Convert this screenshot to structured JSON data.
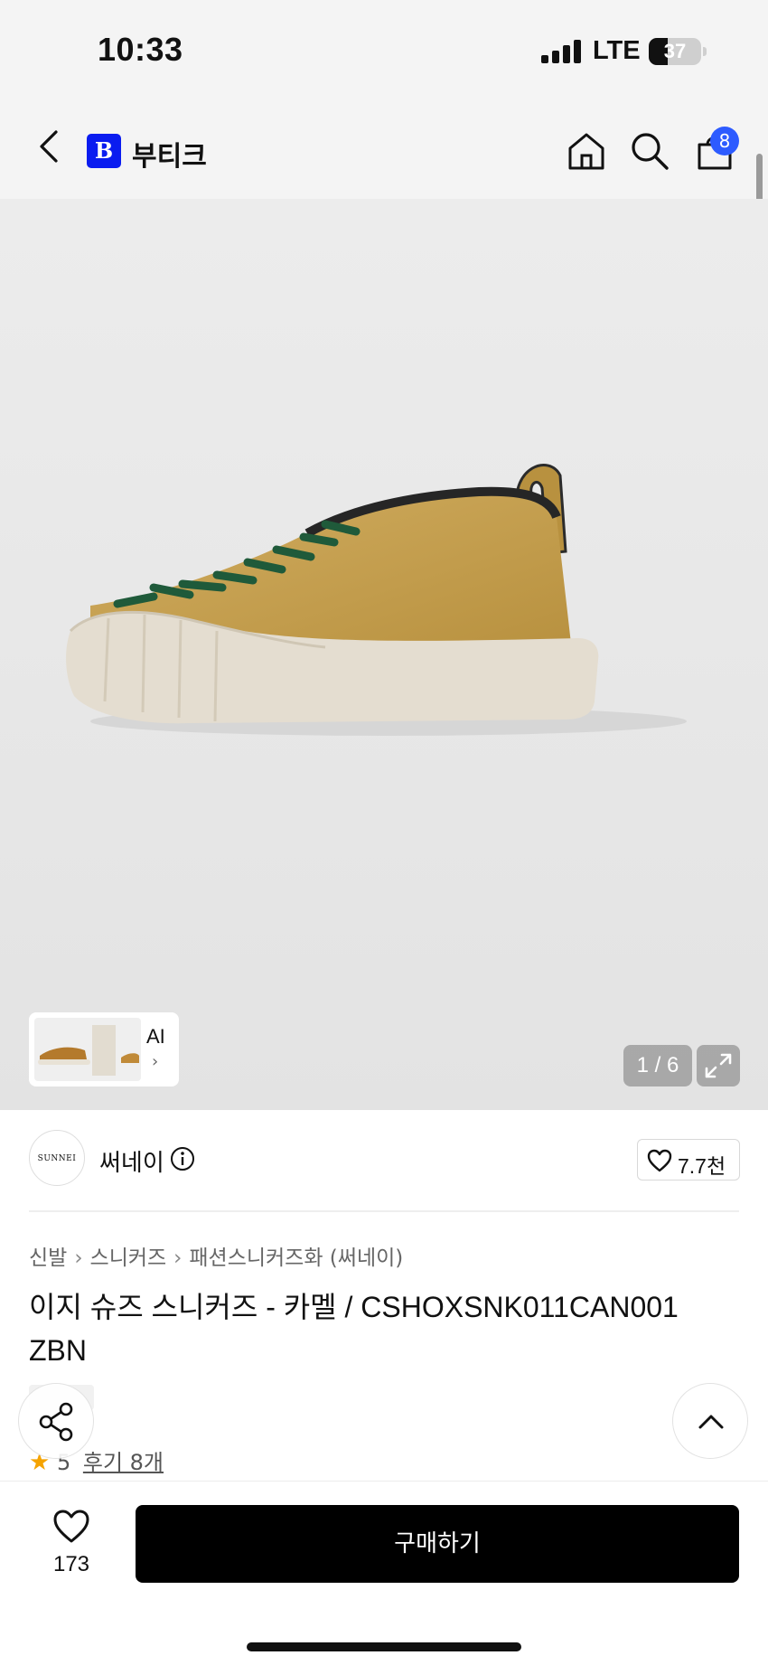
{
  "status_bar": {
    "time": "10:33",
    "network": "LTE",
    "battery": "37"
  },
  "header": {
    "brand_logo": "B",
    "brand_name": "부티크",
    "cart_count": "8"
  },
  "gallery": {
    "ai_label": "AI",
    "counter": "1 / 6"
  },
  "seller": {
    "logo_text": "SUNNEI",
    "name": "써네이",
    "likes": "7.7천"
  },
  "breadcrumb": [
    "신발",
    "스니커즈",
    "패션스니커즈화 (써네이)"
  ],
  "product": {
    "title": "이지 슈즈 스니커즈 - 카멜 / CSHOXSNK011CAN001 ZBN"
  },
  "rating": {
    "score": "5",
    "reviews": "후기 8개"
  },
  "bottom_bar": {
    "wish_count": "173",
    "buy_label": "구매하기"
  },
  "colors": {
    "accent_blue": "#0a1cf0",
    "badge_blue": "#2d5bff",
    "buy_button": "#000000",
    "star": "#f5a300"
  },
  "icons": [
    "back-icon",
    "home-icon",
    "search-icon",
    "cart-icon",
    "info-icon",
    "heart-icon",
    "share-icon",
    "chevron-up-icon",
    "expand-icon"
  ]
}
